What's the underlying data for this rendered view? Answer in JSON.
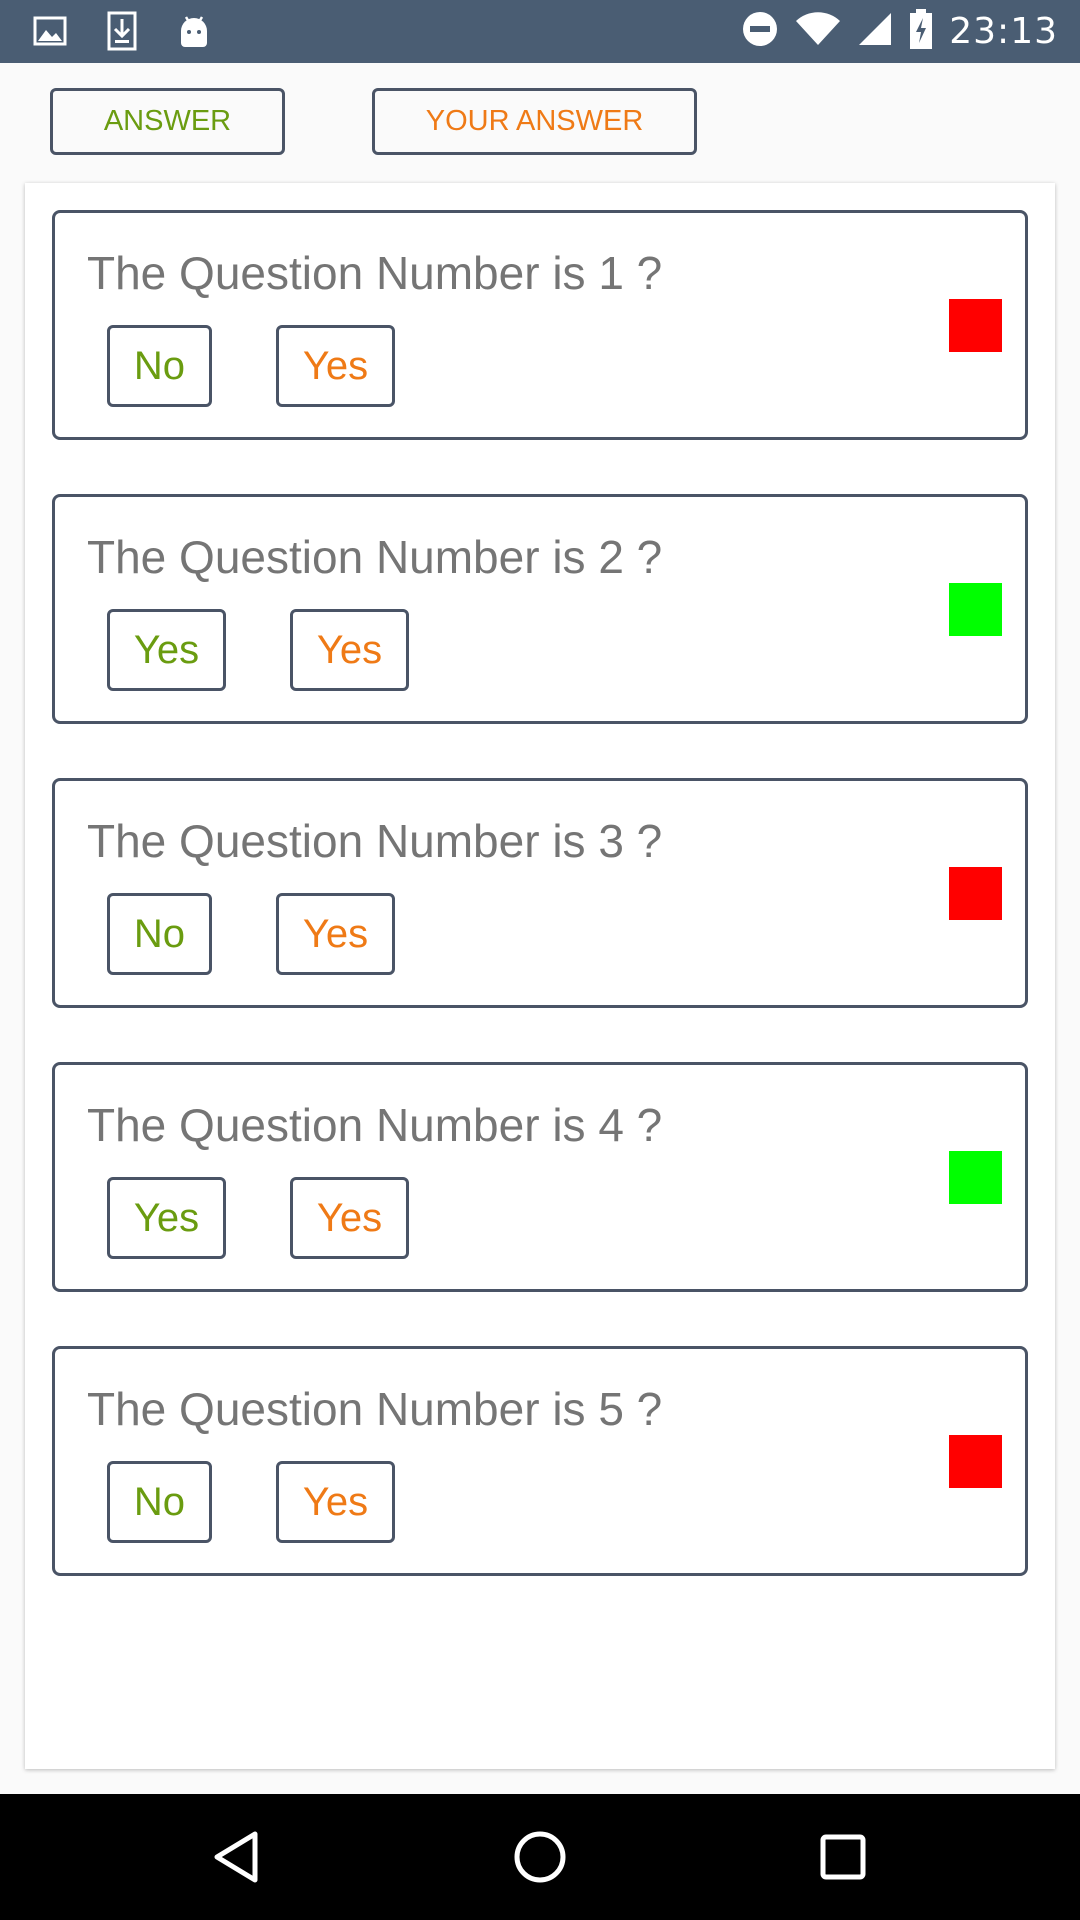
{
  "status_bar": {
    "time": "23:13",
    "left_icons": [
      "image-icon",
      "download-icon",
      "android-icon"
    ],
    "right_icons": [
      "dnd-icon",
      "wifi-icon",
      "signal-icon",
      "battery-charging-icon"
    ]
  },
  "top_buttons": {
    "answer_label": "ANSWER",
    "your_answer_label": "YOUR ANSWER"
  },
  "colors": {
    "answer_text": "#6a9c10",
    "your_answer_text": "#ef7a16",
    "wrong": "#ff0000",
    "correct": "#00ff00"
  },
  "questions": [
    {
      "text": "The Question Number is 1 ?",
      "answer": "No",
      "your_answer": "Yes",
      "status": "wrong"
    },
    {
      "text": "The Question Number is 2 ?",
      "answer": "Yes",
      "your_answer": "Yes",
      "status": "correct"
    },
    {
      "text": "The Question Number is 3 ?",
      "answer": "No",
      "your_answer": "Yes",
      "status": "wrong"
    },
    {
      "text": "The Question Number is 4 ?",
      "answer": "Yes",
      "your_answer": "Yes",
      "status": "correct"
    },
    {
      "text": "The Question Number is 5 ?",
      "answer": "No",
      "your_answer": "Yes",
      "status": "wrong"
    }
  ],
  "nav_bar": {
    "icons": [
      "back-icon",
      "home-icon",
      "recents-icon"
    ]
  }
}
